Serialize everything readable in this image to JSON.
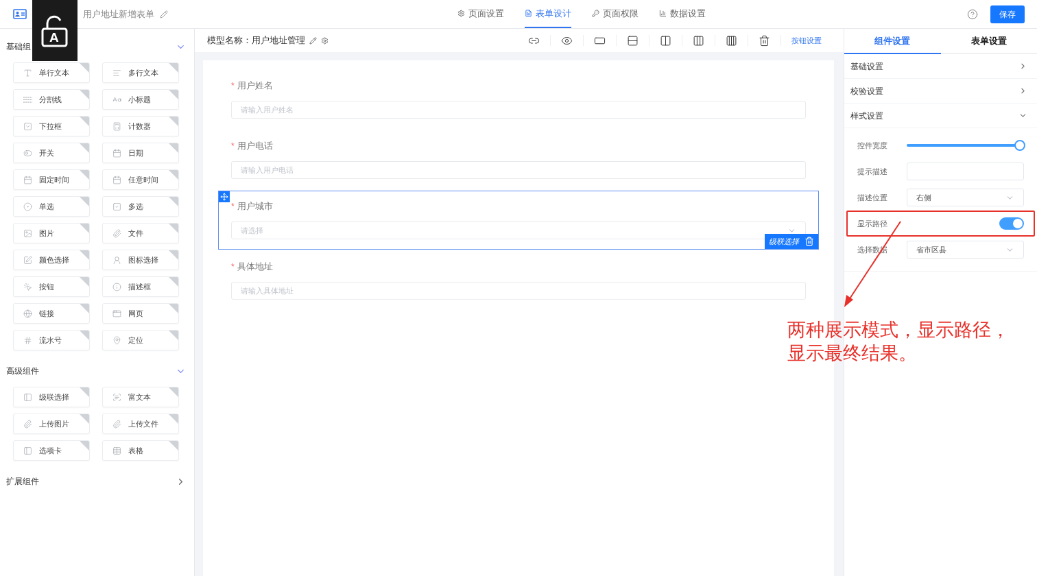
{
  "header": {
    "title": "用户地址新增表单",
    "tabs": [
      {
        "label": "页面设置",
        "selected": false
      },
      {
        "label": "表单设计",
        "selected": true
      },
      {
        "label": "页面权限",
        "selected": false
      },
      {
        "label": "数据设置",
        "selected": false
      }
    ],
    "save": "保存"
  },
  "overlay": {
    "letter": "A"
  },
  "palette": {
    "groups": [
      {
        "title": "基础组",
        "expanded": true,
        "items": [
          "单行文本",
          "多行文本",
          "分割线",
          "小标题",
          "下拉框",
          "计数器",
          "开关",
          "日期",
          "固定时间",
          "任意时间",
          "单选",
          "多选",
          "图片",
          "文件",
          "颜色选择",
          "图标选择",
          "按钮",
          "描述框",
          "链接",
          "网页",
          "流水号",
          "定位"
        ]
      },
      {
        "title": "高级组件",
        "expanded": true,
        "items": [
          "级联选择",
          "富文本",
          "上传图片",
          "上传文件",
          "选项卡",
          "表格"
        ]
      },
      {
        "title": "扩展组件",
        "expanded": false
      }
    ]
  },
  "canvas": {
    "model_label": "模型名称：",
    "model_name": "用户地址管理",
    "button_settings": "按钮设置",
    "fields": [
      {
        "kind": "input",
        "label": "用户姓名",
        "required_mark": "*",
        "placeholder": "请输入用户姓名",
        "selected": false
      },
      {
        "kind": "input",
        "label": "用户电话",
        "required_mark": "*",
        "placeholder": "请输入用户电话",
        "selected": false
      },
      {
        "kind": "select",
        "label": "用户城市",
        "required_mark": "*",
        "placeholder": "请选择",
        "selected": true,
        "type_badge": "级联选择"
      },
      {
        "kind": "input",
        "label": "具体地址",
        "required_mark": "*",
        "placeholder": "请输入具体地址",
        "selected": false
      }
    ]
  },
  "settings": {
    "tabs": [
      {
        "label": "组件设置",
        "selected": true
      },
      {
        "label": "表单设置",
        "selected": false
      }
    ],
    "sections": [
      {
        "title": "基础设置",
        "expanded": false
      },
      {
        "title": "校验设置",
        "expanded": false
      },
      {
        "title": "样式设置",
        "expanded": true
      }
    ],
    "rows": [
      {
        "kind": "slider",
        "label": "控件宽度",
        "level": 1
      },
      {
        "kind": "input",
        "label": "提示描述"
      },
      {
        "kind": "select",
        "label": "描述位置",
        "value": "右侧"
      },
      {
        "kind": "switch",
        "label": "显示路径",
        "on": true,
        "highlighted": true
      },
      {
        "kind": "select",
        "label": "选择数据",
        "value": "省市区县"
      }
    ]
  },
  "annotation": {
    "lines": [
      "两种展示模式，显示路径，",
      "显示最终结果。"
    ]
  }
}
